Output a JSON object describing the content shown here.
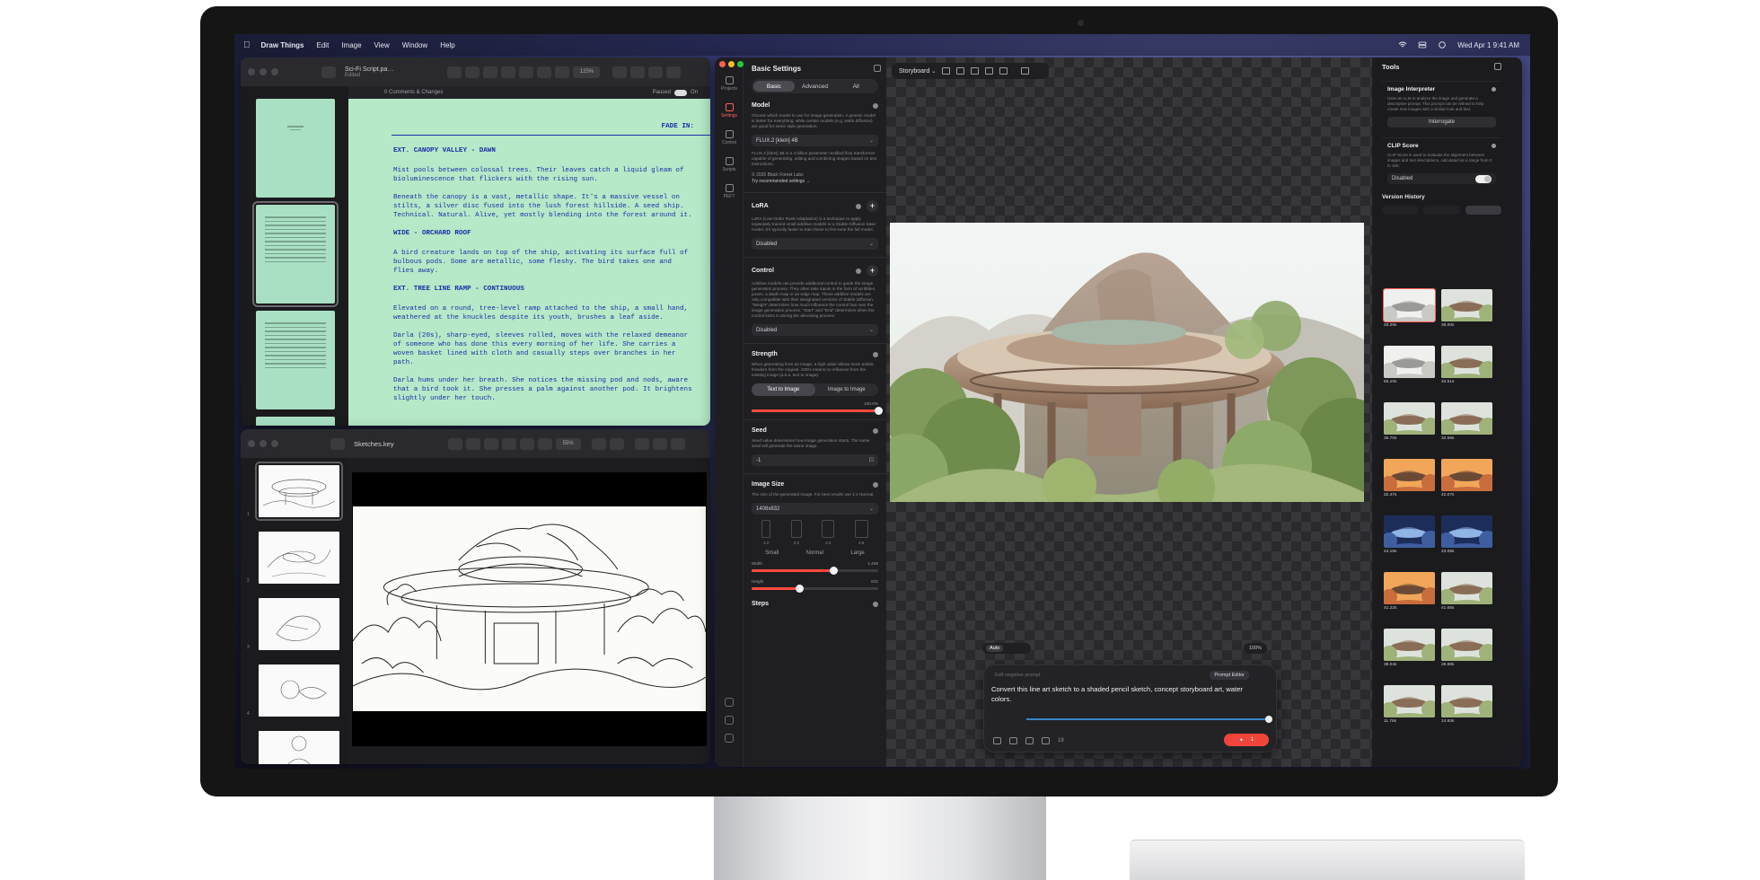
{
  "menubar": {
    "app": "Draw Things",
    "items": [
      "Edit",
      "Image",
      "View",
      "Window",
      "Help"
    ],
    "clock": "Wed Apr 1  9:41 AM"
  },
  "screenplay": {
    "title": "Sci-Fi Script.pa…",
    "subtitle": "Edited",
    "zoom": "125%",
    "comments": "0 Comments & Changes",
    "paused": "Paused",
    "on": "On",
    "fade_in": "FADE IN:",
    "blocks": [
      {
        "type": "sh",
        "text": "EXT. CANOPY VALLEY - DAWN"
      },
      {
        "type": "p",
        "text": "Mist pools between colossal trees. Their leaves catch a liquid gleam of bioluminescence that flickers with the rising sun."
      },
      {
        "type": "p",
        "text": "Beneath the canopy is a vast, metallic shape. It's a massive vessel on stilts, a silver disc fused into the lush forest hillside. A seed ship. Technical. Natural. Alive, yet mostly blending into the forest around it."
      },
      {
        "type": "sh",
        "text": "WIDE - ORCHARD ROOF"
      },
      {
        "type": "p",
        "text": "A bird creature lands on top of the ship, activating its surface full of bulbous pods. Some are metallic, some fleshy. The bird takes one and flies away."
      },
      {
        "type": "sh",
        "text": "EXT. TREE LINE RAMP - CONTINUOUS"
      },
      {
        "type": "p",
        "text": "Elevated on a round, tree-level ramp attached to the ship, a small hand, weathered at the knuckles despite its youth, brushes a leaf aside."
      },
      {
        "type": "p",
        "text": "Darla (20s), sharp-eyed, sleeves rolled, moves with the relaxed demeanor of someone who has done this every morning of her life. She carries a woven basket lined with cloth and casually steps over branches in her path."
      },
      {
        "type": "p",
        "text": "Darla hums under her breath. She notices the missing pod and nods, aware that a bird took it. She presses a palm against another pod. It brightens slightly under her touch."
      }
    ]
  },
  "sketches": {
    "title": "Sketches.key",
    "zoom": "55%",
    "slide_numbers": [
      "1",
      "2",
      "3",
      "4",
      "5"
    ]
  },
  "settings": {
    "title": "Basic Settings",
    "rail": [
      "Projects",
      "Settings",
      "Control",
      "Scripts",
      "PEFT"
    ],
    "tabs": [
      "Basic",
      "Advanced",
      "All"
    ],
    "model": {
      "label": "Model",
      "desc": "Choose which model to use for image generation. A generic model is better for everything, while certain models (e.g. waifu diffusion) are good for some style generation.",
      "value": "FLUX.2 [klein] 4B",
      "info": "FLUX.2 [klein] 4B is a 4 billion parameter rectified flow transformer capable of generating, editing and combining images based on text instructions.",
      "copyright": "© 2026 Black Forest Labs",
      "link": "Try recommended settings →"
    },
    "lora": {
      "label": "LoRA",
      "desc": "LoRA (Low-Order Rank Adaptation) is a technique to apply separately trained small additive models to a Stable Diffusion base model. It's typically faster to train these to fine-tune the full model.",
      "value": "Disabled"
    },
    "control": {
      "label": "Control",
      "desc": "Additive models can provide additional control to guide the image generation process. They often take inputs in the form of scribbles, poses, a depth map or an edge map. These additive models are only compatible with their designated versions of Stable Diffusion. \"Weight\" determines how much influence the control has over the image generation process. \"Start\" and \"End\" determines when the control kicks in during the denoising process.",
      "value": "Disabled"
    },
    "strength": {
      "label": "Strength",
      "desc": "When generating from an image, a high value allows more artistic freedom from the original. 100% means no influence from the existing image (a.k.a. text to image).",
      "modes": [
        "Text to Image",
        "Image to Image"
      ],
      "value_label": "100.0%",
      "value": 1.0
    },
    "seed": {
      "label": "Seed",
      "desc": "Seed value determines how image generation starts. The same seed will generate the same image.",
      "value": "-1"
    },
    "image_size": {
      "label": "Image Size",
      "desc": "The size of the generated image. For best results use 1:1 Normal.",
      "value": "1408x832",
      "ratios": [
        "1:2",
        "2:3",
        "3:4",
        "4:5"
      ],
      "sizes": [
        "Small",
        "Normal",
        "Large"
      ],
      "width_label": "Width",
      "width_value": "1,408",
      "width": 0.65,
      "height_label": "Height",
      "height_value": "832",
      "height": 0.38
    },
    "steps_label": "Steps"
  },
  "canvas": {
    "board": "Storyboard",
    "zoom": "100%",
    "auto": "Auto"
  },
  "prompt": {
    "placeholder": "Edit negative prompt",
    "editor": "Prompt Editor",
    "text": "Convert this line art sketch to a shaded pencil sketch, concept storyboard art, water colors.",
    "count": "19",
    "batch": "1"
  },
  "tools": {
    "title": "Tools",
    "interpreter": {
      "title": "Image Interpreter",
      "desc": "Uses an LLM to analyze the image and generate a descriptive prompt. This prompt can be refined to help create new images with a similar look and feel.",
      "button": "Interrogate"
    },
    "clip": {
      "title": "CLIP Score",
      "desc": "CLIP Score is used to evaluate the alignment between images and text descriptions, calculated as a range from 0 to 100.",
      "value": "Disabled"
    },
    "history_title": "Version History",
    "history": [
      {
        "time": "48.25s",
        "tone": "sketch"
      },
      {
        "time": "36.00s",
        "tone": "day"
      },
      {
        "time": "65.10s",
        "tone": "sketch"
      },
      {
        "time": "34.61s",
        "tone": "day"
      },
      {
        "time": "35.70s",
        "tone": "day"
      },
      {
        "time": "32.58s",
        "tone": "day"
      },
      {
        "time": "32.47s",
        "tone": "sunset"
      },
      {
        "time": "42.07s",
        "tone": "sunset"
      },
      {
        "time": "44.15s",
        "tone": "night"
      },
      {
        "time": "43.08s",
        "tone": "night"
      },
      {
        "time": "41.22s",
        "tone": "sunset"
      },
      {
        "time": "41.65s",
        "tone": "day"
      },
      {
        "time": "38.04s",
        "tone": "day"
      },
      {
        "time": "26.88s",
        "tone": "day"
      },
      {
        "time": "11.78s",
        "tone": "day"
      },
      {
        "time": "14.93s",
        "tone": "day"
      }
    ]
  },
  "colors": {
    "accent": "#f0453a",
    "script_bg": "#b5e9c7",
    "script_ink": "#1d2ea8"
  }
}
